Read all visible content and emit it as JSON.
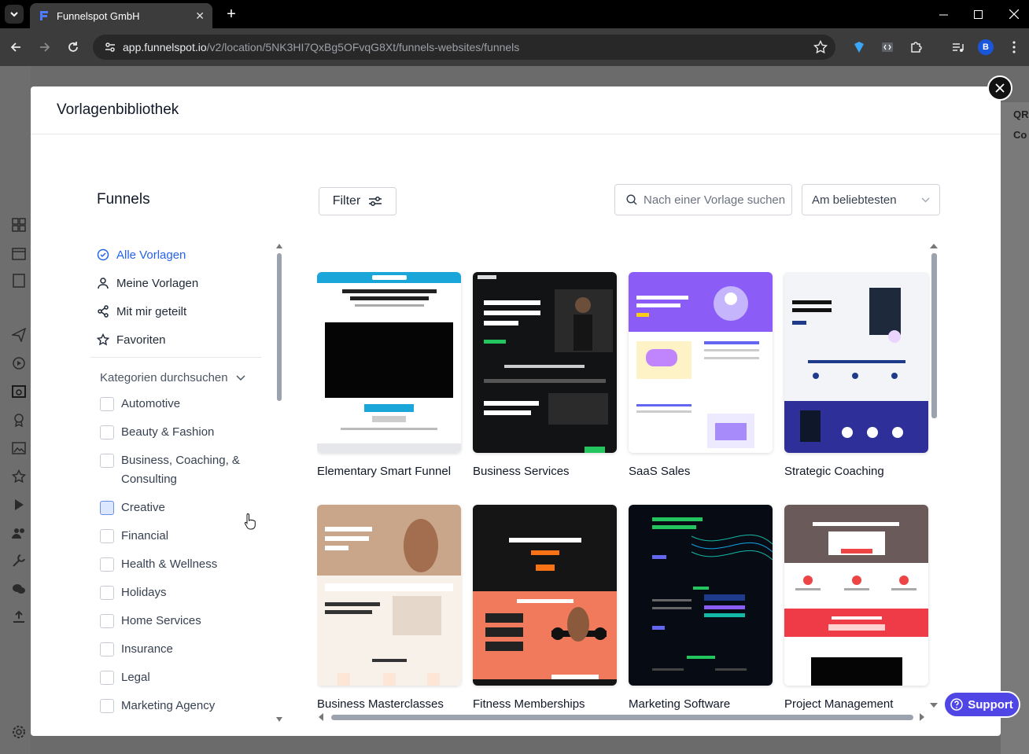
{
  "browser": {
    "tab_title": "Funnelspot GmbH",
    "url_host": "app.funnelspot.io",
    "url_path": "/v2/location/5NK3HI7QxBg5OFvqG8Xt/funnels-websites/funnels",
    "profile_initial": "B"
  },
  "background": {
    "right_labels": [
      "QR",
      "Co"
    ]
  },
  "modal": {
    "title": "Vorlagenbibliothek",
    "section_title": "Funnels",
    "nav": [
      {
        "label": "Alle Vorlagen",
        "icon": "check-circle-icon",
        "active": true
      },
      {
        "label": "Meine Vorlagen",
        "icon": "user-icon",
        "active": false
      },
      {
        "label": "Mit mir geteilt",
        "icon": "share-icon",
        "active": false
      },
      {
        "label": "Favoriten",
        "icon": "star-icon",
        "active": false
      }
    ],
    "categories_heading": "Kategorien durchsuchen",
    "categories": [
      "Automotive",
      "Beauty & Fashion",
      "Business, Coaching, & Consulting",
      "Creative",
      "Financial",
      "Health & Wellness",
      "Holidays",
      "Home Services",
      "Insurance",
      "Legal",
      "Marketing Agency"
    ],
    "filter_label": "Filter",
    "search_placeholder": "Nach einer Vorlage suchen",
    "sort_value": "Am beliebtesten",
    "templates": [
      {
        "name": "Elementary Smart Funnel",
        "theme": "light-video"
      },
      {
        "name": "Business Services",
        "theme": "dark"
      },
      {
        "name": "SaaS Sales",
        "theme": "purple"
      },
      {
        "name": "Strategic Coaching",
        "theme": "navy"
      },
      {
        "name": "Business Masterclasses",
        "theme": "beige"
      },
      {
        "name": "Fitness Memberships",
        "theme": "fitness"
      },
      {
        "name": "Marketing Software",
        "theme": "dark-tech"
      },
      {
        "name": "Project Management",
        "theme": "red-event"
      }
    ],
    "support_label": "Support",
    "colors": {
      "accent": "#2563eb",
      "support": "#4f46e5"
    }
  }
}
